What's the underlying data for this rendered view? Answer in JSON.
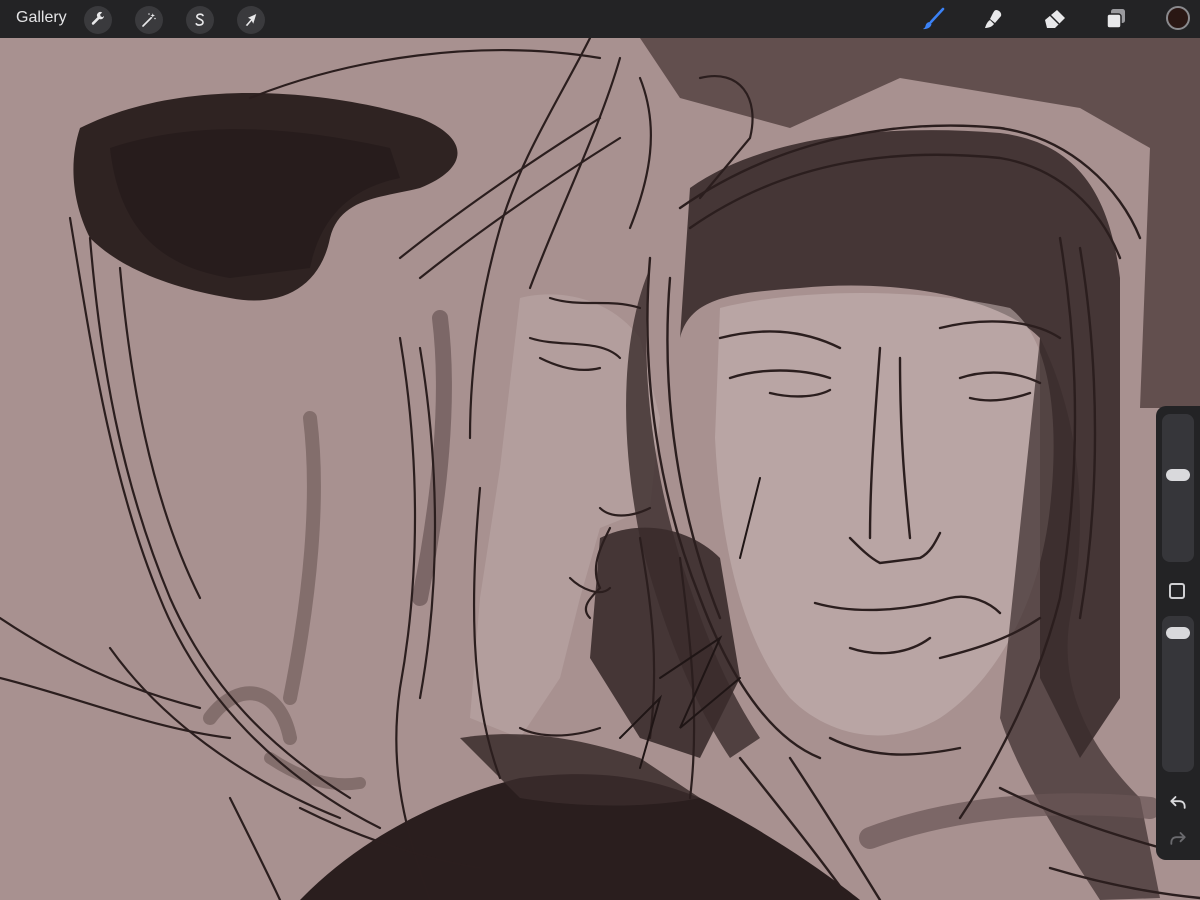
{
  "toolbar": {
    "gallery_label": "Gallery",
    "left_tools": [
      {
        "name": "actions",
        "icon": "wrench-icon"
      },
      {
        "name": "adjustments",
        "icon": "magic-wand-icon"
      },
      {
        "name": "selection",
        "icon": "selection-s-icon"
      },
      {
        "name": "transform",
        "icon": "arrow-cursor-icon"
      }
    ],
    "right_tools": [
      {
        "name": "brush",
        "icon": "brush-icon",
        "active": true
      },
      {
        "name": "smudge",
        "icon": "smudge-icon",
        "active": false
      },
      {
        "name": "eraser",
        "icon": "eraser-icon",
        "active": false
      },
      {
        "name": "layers",
        "icon": "layers-icon",
        "active": false
      }
    ],
    "current_color": "#2a1714"
  },
  "sidebar": {
    "brush_size": 0.6,
    "brush_opacity": 0.95,
    "undo_icon": "undo-icon",
    "redo_icon": "redo-icon"
  },
  "colors": {
    "canvas_bg": "#a89190",
    "ink": "#2b1e1e",
    "wash_dark": "#3a2c2c",
    "wash_mid": "#6a5655",
    "skin_light": "#c2b0ae",
    "accent_active": "#3b82f6"
  }
}
